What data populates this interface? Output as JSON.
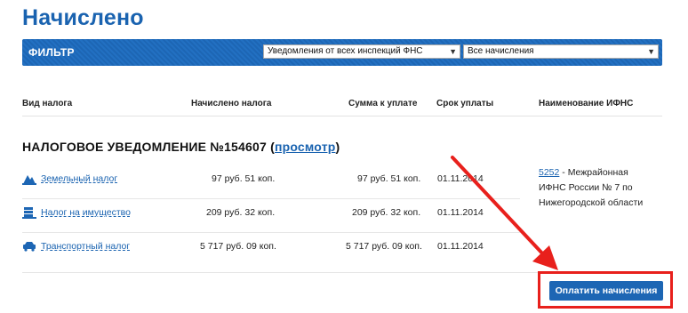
{
  "page": {
    "title": "Начислено"
  },
  "filter": {
    "label": "ФИЛЬТР",
    "select_source": "Уведомления от всех инспекций ФНС",
    "select_type": "Все начисления"
  },
  "table": {
    "headers": {
      "tax_type": "Вид налога",
      "accrued": "Начислено налога",
      "due_amount": "Сумма к уплате",
      "due_date": "Срок уплаты",
      "ifns_name": "Наименование ИФНС"
    },
    "notice": {
      "title_prefix": "НАЛОГОВОЕ УВЕДОМЛЕНИЕ №154607 (",
      "view_link": "просмотр",
      "title_suffix": ")"
    },
    "rows": [
      {
        "icon": "land-tax-icon",
        "name": "Земельный налог",
        "accrued": "97 руб. 51 коп.",
        "due": "97 руб. 51 коп.",
        "date": "01.11.2014"
      },
      {
        "icon": "property-tax-icon",
        "name": "Налог на имущество",
        "accrued": "209 руб. 32 коп.",
        "due": "209 руб. 32 коп.",
        "date": "01.11.2014"
      },
      {
        "icon": "transport-tax-icon",
        "name": "Транспортный налог",
        "accrued": "5 717 руб. 09 коп.",
        "due": "5 717 руб. 09 коп.",
        "date": "01.11.2014"
      }
    ],
    "ifns": {
      "code": "5252",
      "text": " - Межрайонная ИФНС России № 7 по Нижегородской области"
    }
  },
  "actions": {
    "pay_button": "Оплатить начисления"
  },
  "colors": {
    "brand_blue": "#1d66b4",
    "link_blue": "#1a63b0",
    "annotation_red": "#e8201c"
  }
}
